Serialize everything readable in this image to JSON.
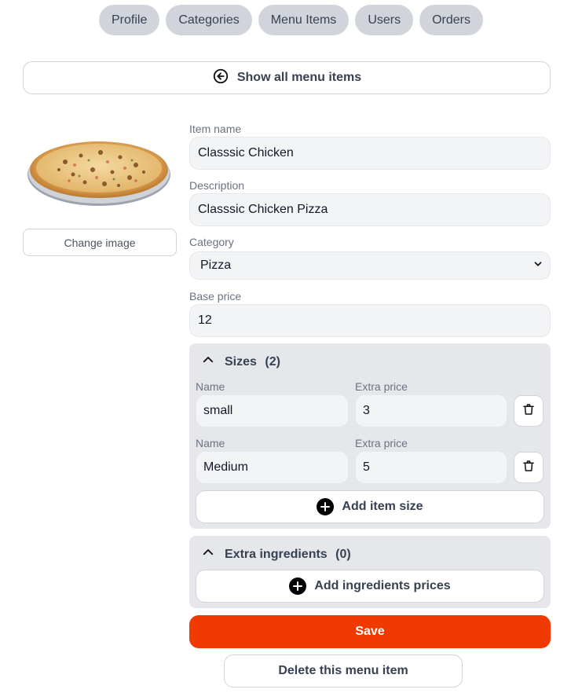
{
  "nav": {
    "tabs": [
      {
        "label": "Profile"
      },
      {
        "label": "Categories"
      },
      {
        "label": "Menu Items"
      },
      {
        "label": "Users"
      },
      {
        "label": "Orders"
      }
    ]
  },
  "back_button": {
    "label": "Show all menu items",
    "icon": "arrow-left-circle-icon"
  },
  "image": {
    "change_label": "Change image"
  },
  "form": {
    "item_name_label": "Item name",
    "item_name_value": "Classsic Chicken",
    "description_label": "Description",
    "description_value": "Classsic Chicken Pizza",
    "category_label": "Category",
    "category_value": "Pizza",
    "base_price_label": "Base price",
    "base_price_value": "12"
  },
  "sizes": {
    "title": "Sizes",
    "count": "(2)",
    "name_label": "Name",
    "price_label": "Extra price",
    "rows": [
      {
        "name": "small",
        "price": "3"
      },
      {
        "name": "Medium",
        "price": "5"
      }
    ],
    "add_label": "Add item size"
  },
  "extras": {
    "title": "Extra ingredients",
    "count": "(0)",
    "add_label": "Add ingredients prices"
  },
  "actions": {
    "save_label": "Save",
    "delete_label": "Delete this menu item"
  },
  "colors": {
    "accent": "#f13a01",
    "tab_bg": "#d1d5db",
    "panel_bg": "#e5e7eb",
    "field_bg": "#f3f4f6"
  }
}
